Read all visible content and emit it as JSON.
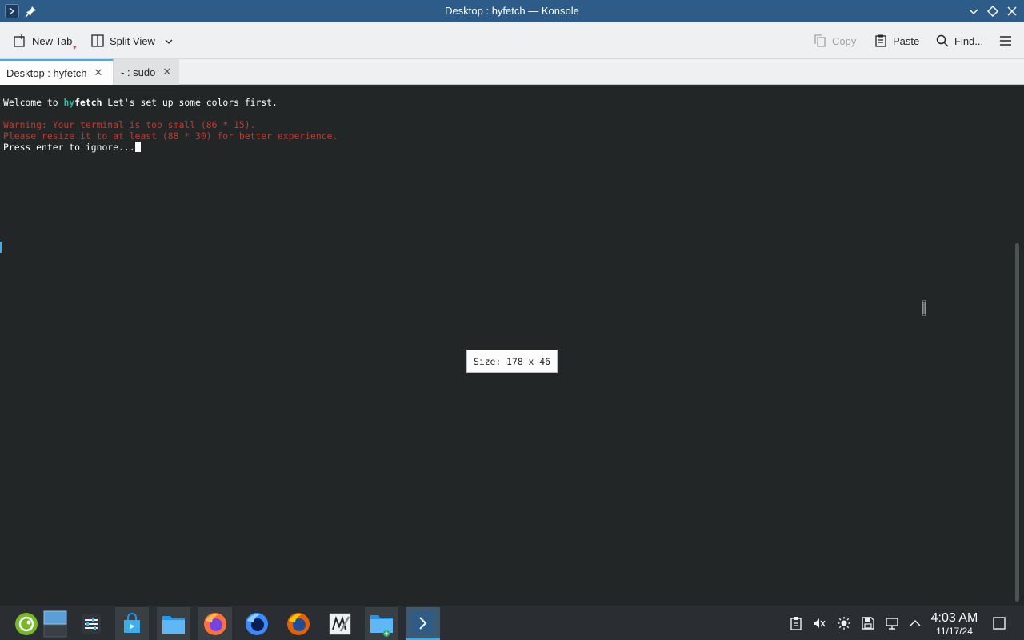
{
  "window": {
    "title": "Desktop : hyfetch — Konsole"
  },
  "toolbar": {
    "new_tab": "New Tab",
    "split_view": "Split View",
    "copy": "Copy",
    "paste": "Paste",
    "find": "Find..."
  },
  "tabs": [
    {
      "label": "Desktop : hyfetch",
      "active": true
    },
    {
      "label": "- : sudo",
      "active": false
    }
  ],
  "terminal": {
    "welcome_prefix": "Welcome to ",
    "welcome_hy": "hy",
    "welcome_fetch": "fetch",
    "welcome_suffix": " Let's set up some colors first.",
    "warning_line1": "Warning: Your terminal is too small (86 * 15).",
    "warning_line2": "Please resize it to at least (88 * 30) for better experience.",
    "prompt_line": "Press enter to ignore...",
    "size_tooltip": "Size: 178 x 46"
  },
  "taskbar": {
    "apps": [
      "application-launcher",
      "desktop-pager",
      "system-settings",
      "discover",
      "dolphin",
      "firefox-developer",
      "firefox-nightly",
      "firefox",
      "text-editor",
      "dolphin-new",
      "konsole"
    ],
    "clock_time": "4:03 AM",
    "clock_date": "11/17/24"
  },
  "colors": {
    "titlebar": "#2d5c88",
    "terminal_bg": "#232627",
    "warning": "#c0392b",
    "accent": "#3daee9",
    "hy": "#1abc9c"
  }
}
